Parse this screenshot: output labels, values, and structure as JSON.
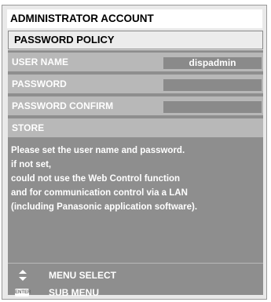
{
  "window": {
    "title": "ADMINISTRATOR ACCOUNT"
  },
  "policy": {
    "label": "PASSWORD POLICY"
  },
  "form": {
    "user_name": {
      "label": "USER NAME",
      "value": "dispadmin"
    },
    "password": {
      "label": "PASSWORD",
      "value": ""
    },
    "password_confirm": {
      "label": "PASSWORD CONFIRM",
      "value": ""
    },
    "store": {
      "label": "STORE"
    }
  },
  "help_lines": [
    "Please set the user name and password.",
    "if not set,",
    "could not use the Web Control function",
    "and for communication control via a LAN",
    "(including Panasonic application software)."
  ],
  "footer": {
    "menu_select": {
      "icon": "up-down-arrows-icon",
      "label": "MENU SELECT"
    },
    "sub_menu": {
      "icon": "enter-key-icon",
      "icon_text": "ENTER",
      "label": "SUB MENU"
    }
  },
  "colors": {
    "panel_bg": "#e9e9e9",
    "body_bg": "#8e8e8e",
    "row_bg": "#b8b8b8",
    "field_bg": "#8a8a8a"
  }
}
